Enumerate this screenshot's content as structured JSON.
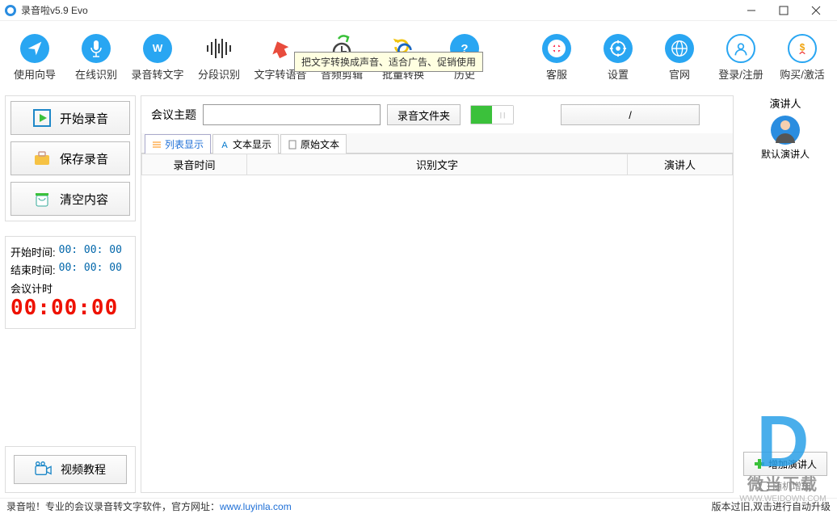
{
  "window": {
    "title": "录音啦v5.9 Evo"
  },
  "tooltip": "把文字转换成声音、适合广告、促销使用",
  "toolbar": {
    "guide": "使用向导",
    "online": "在线识别",
    "rec2txt": "录音转文字",
    "segment": "分段识别",
    "tts": "文字转语音",
    "audioedit": "音频剪辑",
    "batch": "批量转换",
    "history": "历史",
    "service": "客服",
    "settings": "设置",
    "website": "官网",
    "login": "登录/注册",
    "buy": "购买/激活"
  },
  "left": {
    "start": "开始录音",
    "save": "保存录音",
    "clear": "清空内容",
    "start_time_label": "开始时间:",
    "start_time_val": "00: 00: 00",
    "end_time_label": "结束时间:",
    "end_time_val": "00: 00: 00",
    "timer_label": "会议计时",
    "timer_val": "00:00:00",
    "tutorial": "视频教程"
  },
  "center": {
    "topic_label": "会议主题",
    "topic_value": "",
    "folder_btn": "录音文件夹",
    "slash": "/",
    "tab_list": "列表显示",
    "tab_text": "文本显示",
    "tab_raw": "原始文本",
    "col1": "录音时间",
    "col2": "识别文字",
    "col3": "演讲人"
  },
  "right": {
    "header": "演讲人",
    "default_name": "默认演讲人",
    "add": "增加演讲人",
    "random": "随机增加"
  },
  "status": {
    "left1": "录音啦！专业的会议录音转文字软件，官方网址：",
    "url": "www.luyinla.com",
    "right": "版本过旧,双击进行自动升级"
  },
  "watermark": {
    "big": "D",
    "txt": "微当下载",
    "url": "WWW.WEIDOWN.COM"
  }
}
